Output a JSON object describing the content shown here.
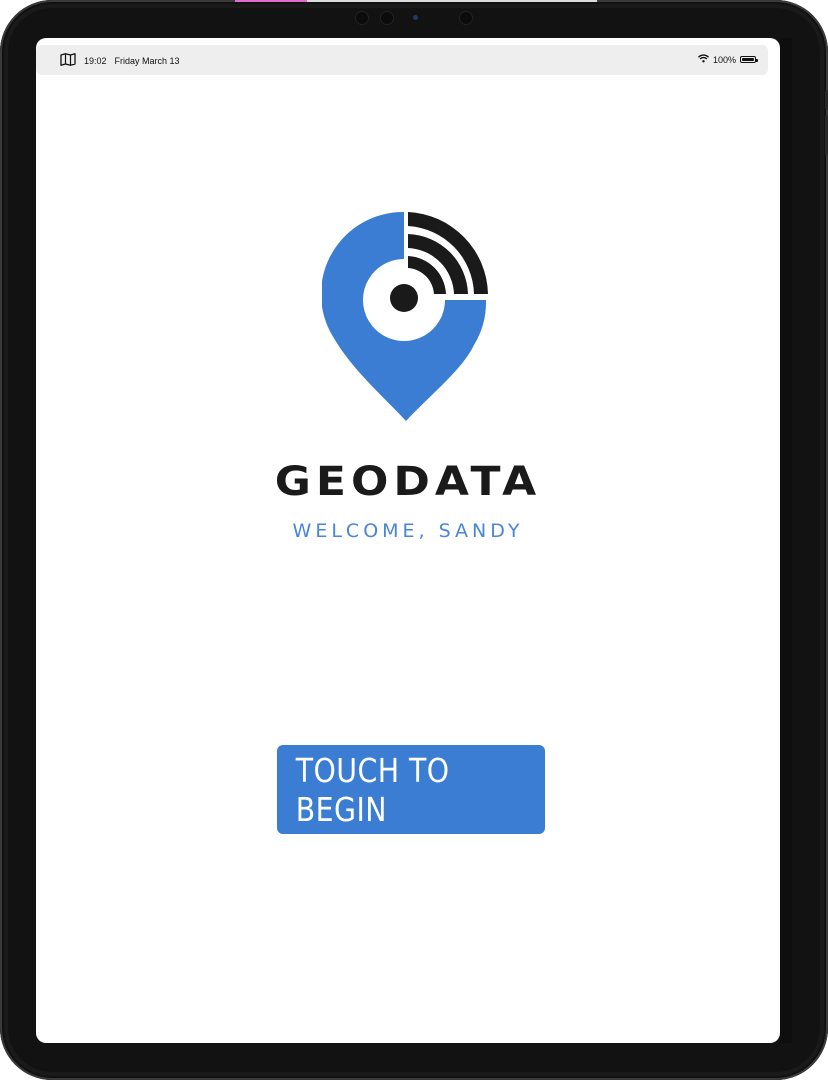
{
  "status_bar": {
    "time": "19:02",
    "date": "Friday March 13",
    "battery_text": "100%",
    "battery_level": 1.0,
    "left_icon": "map-icon",
    "wifi_icon": "wifi-icon"
  },
  "app": {
    "brand_name": "GEODATA",
    "welcome_text": "WELCOME, SANDY",
    "begin_label": "TOUCH TO BEGIN"
  },
  "colors": {
    "accent_blue": "#3a7dd3",
    "welcome_blue": "#4a86d8",
    "logo_blue": "#3a7dd3",
    "logo_dark": "#1a1a1a"
  }
}
